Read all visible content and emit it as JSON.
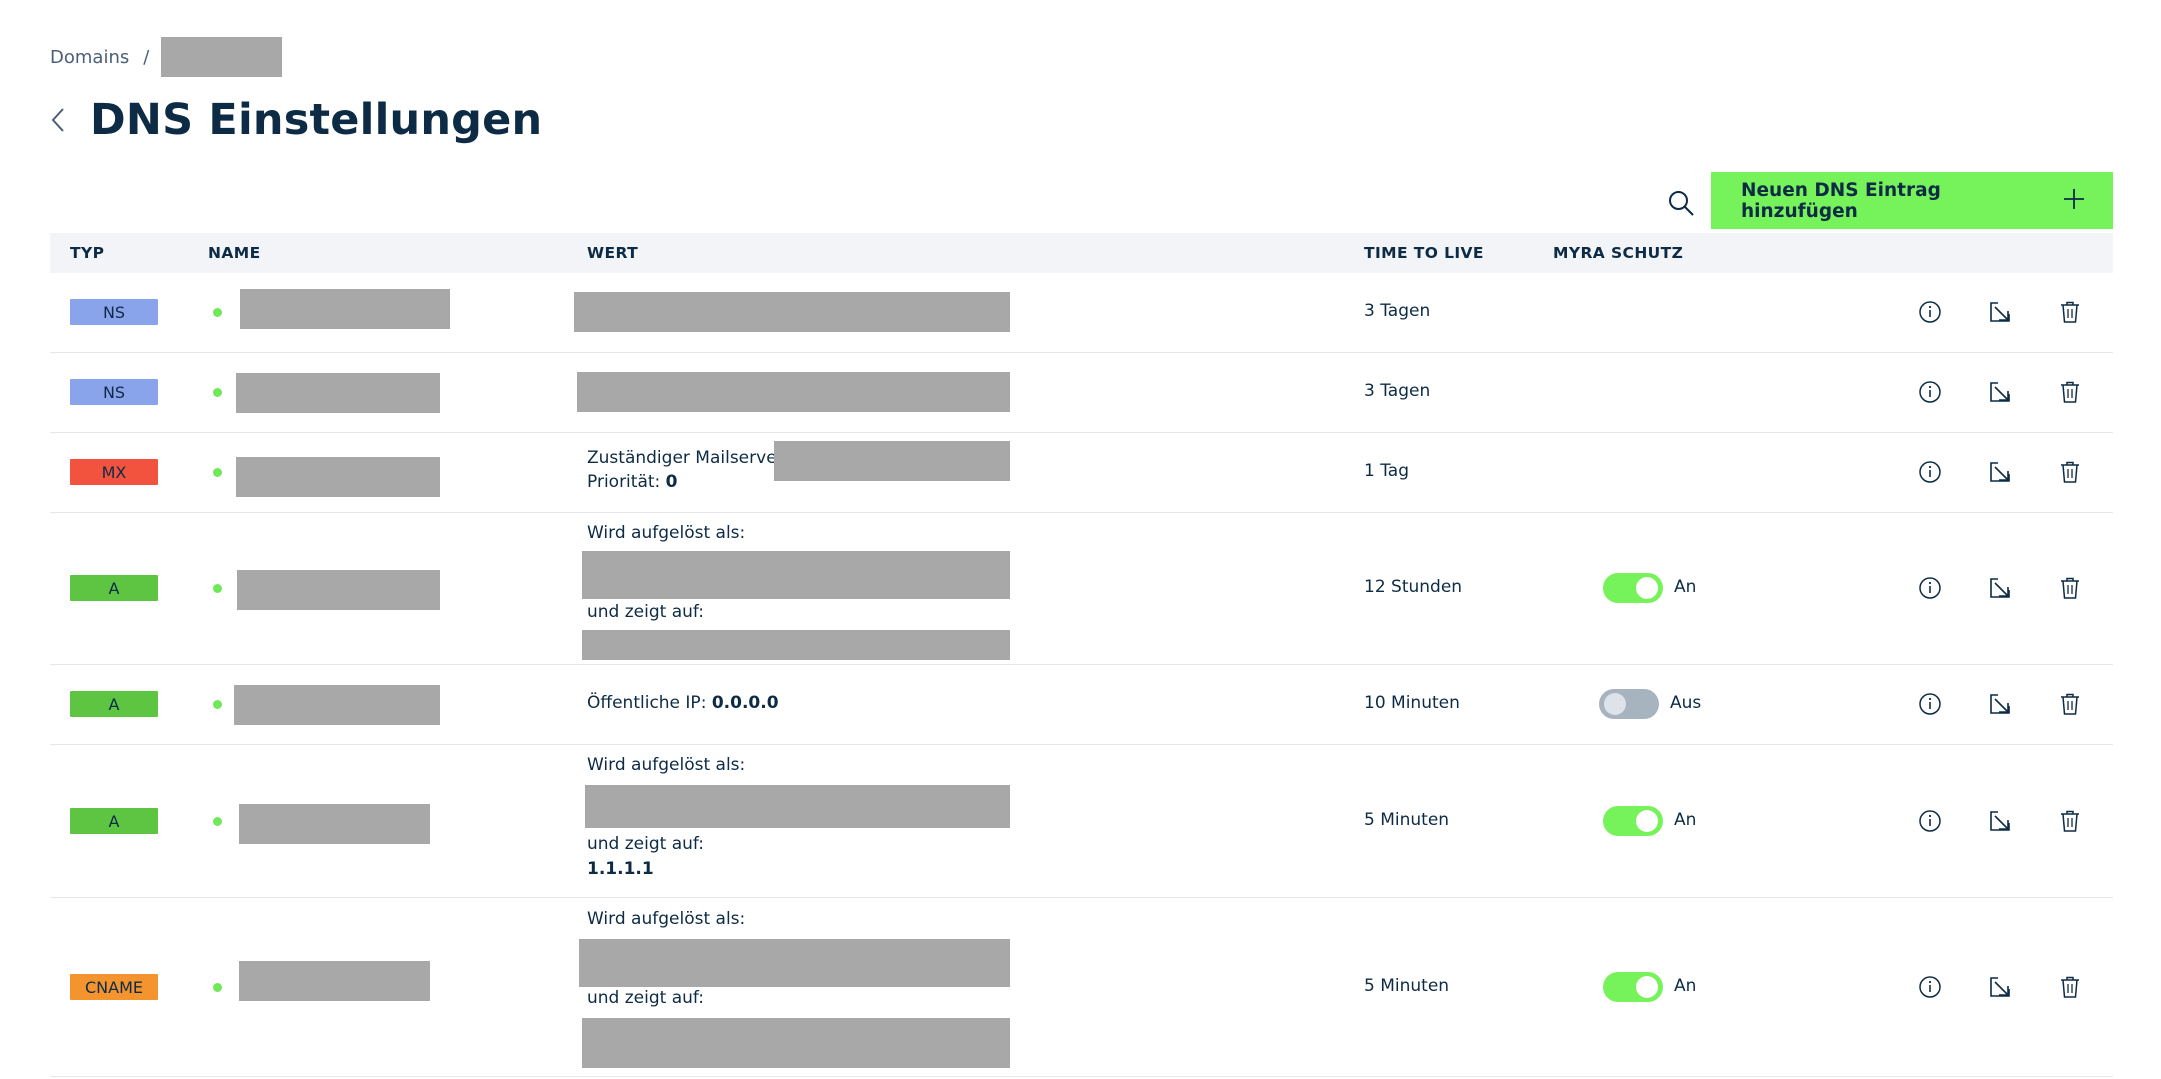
{
  "breadcrumb": {
    "root": "Domains",
    "separator": "/"
  },
  "page": {
    "title": "DNS Einstellungen"
  },
  "toolbar": {
    "add_button_label": "Neuen DNS Eintrag hinzufügen",
    "add_icon": "plus-icon",
    "search_icon": "search-icon"
  },
  "table": {
    "headers": {
      "type": "TYP",
      "name": "NAME",
      "value": "WERT",
      "ttl": "TIME TO LIVE",
      "protection": "MYRA SCHUTZ"
    },
    "rows": [
      {
        "type": "NS",
        "ttl": "3 Tagen"
      },
      {
        "type": "NS",
        "ttl": "3 Tagen"
      },
      {
        "type": "MX",
        "mail_label": "Zuständiger Mailserver:",
        "priority_label": "Priorität:",
        "priority": "0",
        "ttl": "1 Tag"
      },
      {
        "type": "A",
        "resolved_label": "Wird aufgelöst als:",
        "points_label": "und zeigt auf:",
        "ttl": "12 Stunden",
        "protection": "An"
      },
      {
        "type": "A",
        "ip_label": "Öffentliche IP:",
        "ip": "0.0.0.0",
        "ttl": "10 Minuten",
        "protection": "Aus"
      },
      {
        "type": "A",
        "resolved_label": "Wird aufgelöst als:",
        "points_label": "und zeigt auf:",
        "points_to": "1.1.1.1",
        "ttl": "5 Minuten",
        "protection": "An"
      },
      {
        "type": "CNAME",
        "resolved_label": "Wird aufgelöst als:",
        "points_label": "und zeigt auf:",
        "ttl": "5 Minuten",
        "protection": "An"
      }
    ]
  },
  "colors": {
    "NS": "#8aa4ec",
    "MX": "#f1533e",
    "A": "#5dc541",
    "CNAME": "#f4942f",
    "accent": "#76f25a",
    "text": "#0d2b45"
  },
  "icons": {
    "back": "chevron-left-icon",
    "info": "info-icon",
    "edit": "edit-icon",
    "delete": "trash-icon"
  }
}
